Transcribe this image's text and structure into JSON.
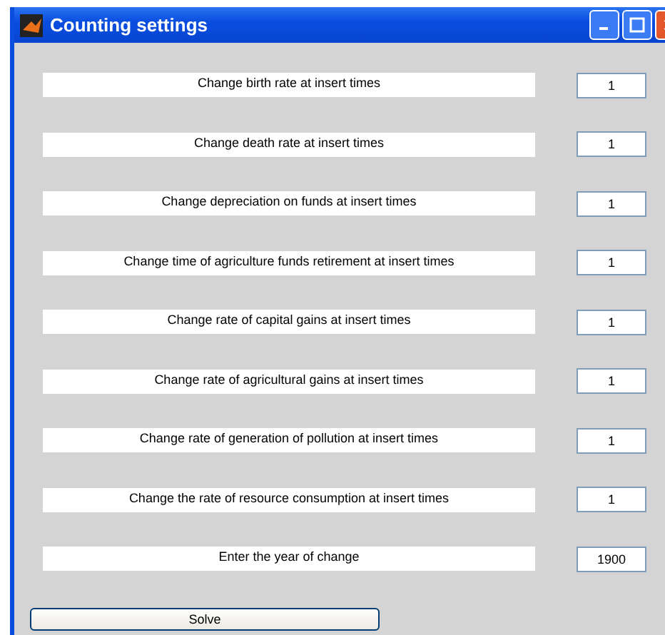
{
  "window": {
    "title": "Counting settings"
  },
  "fields": [
    {
      "label": "Change birth rate at insert times",
      "value": "1"
    },
    {
      "label": "Change death rate at insert times",
      "value": "1"
    },
    {
      "label": "Change depreciation on funds at insert times",
      "value": "1"
    },
    {
      "label": "Change time of agriculture funds retirement at insert times",
      "value": "1"
    },
    {
      "label": "Change rate of capital gains at insert times",
      "value": "1"
    },
    {
      "label": "Change rate of agricultural gains at insert times",
      "value": "1"
    },
    {
      "label": "Change rate of generation of pollution at insert times",
      "value": "1"
    },
    {
      "label": "Change the rate of resource consumption at insert times",
      "value": "1"
    },
    {
      "label": "Enter the year of change",
      "value": "1900"
    }
  ],
  "button": "Solve"
}
